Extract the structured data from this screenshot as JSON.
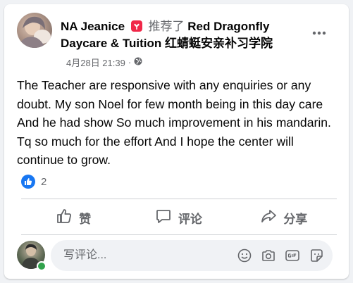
{
  "post": {
    "author": "NA Jeanice",
    "recommend_text": "推荐了",
    "page_name": "Red Dragonfly Daycare & Tuition 红蜻蜓安亲补习学院",
    "timestamp": "4月28日 21:39",
    "separator": "·",
    "privacy_icon": "globe-icon",
    "more_icon": "more-dots-icon",
    "body": "The Teacher are responsive with any enquiries or any doubt. My son Noel for few month being in this day care And he had show So much improvement in his mandarin. Tq so much for the effort And I hope the center will continue to grow."
  },
  "reactions": {
    "icon": "like-icon",
    "count": "2"
  },
  "actions": {
    "like_label": "赞",
    "comment_label": "评论",
    "share_label": "分享"
  },
  "comment": {
    "placeholder": "写评论...",
    "icons": [
      "emoji-icon",
      "camera-icon",
      "gif-icon",
      "sticker-icon"
    ]
  },
  "colors": {
    "brand_blue": "#1877f2",
    "text_secondary": "#65676b",
    "recommend_red": "#f02849",
    "online_green": "#31a24c"
  }
}
